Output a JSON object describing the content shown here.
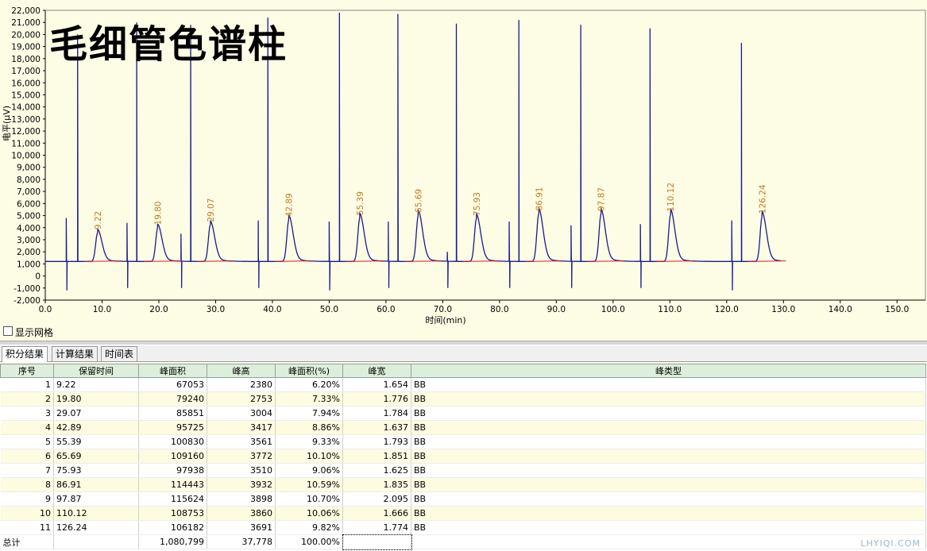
{
  "overlay_title": "毛细管色谱柱",
  "show_grid_label": "显示网格",
  "tabs": [
    {
      "label": "积分结果"
    },
    {
      "label": "计算结果"
    },
    {
      "label": "时间表"
    }
  ],
  "table": {
    "headers": [
      "序号",
      "保留时间",
      "峰面积",
      "峰高",
      "峰面积(%)",
      "峰宽",
      "峰类型"
    ],
    "rows": [
      [
        "1",
        "9.22",
        "67053",
        "2380",
        "6.20%",
        "1.654",
        "BB"
      ],
      [
        "2",
        "19.80",
        "79240",
        "2753",
        "7.33%",
        "1.776",
        "BB"
      ],
      [
        "3",
        "29.07",
        "85851",
        "3004",
        "7.94%",
        "1.784",
        "BB"
      ],
      [
        "4",
        "42.89",
        "95725",
        "3417",
        "8.86%",
        "1.637",
        "BB"
      ],
      [
        "5",
        "55.39",
        "100830",
        "3561",
        "9.33%",
        "1.793",
        "BB"
      ],
      [
        "6",
        "65.69",
        "109160",
        "3772",
        "10.10%",
        "1.851",
        "BB"
      ],
      [
        "7",
        "75.93",
        "97938",
        "3510",
        "9.06%",
        "1.625",
        "BB"
      ],
      [
        "8",
        "86.91",
        "114443",
        "3932",
        "10.59%",
        "1.835",
        "BB"
      ],
      [
        "9",
        "97.87",
        "115624",
        "3898",
        "10.70%",
        "2.095",
        "BB"
      ],
      [
        "10",
        "110.12",
        "108753",
        "3860",
        "10.06%",
        "1.666",
        "BB"
      ],
      [
        "11",
        "126.24",
        "106182",
        "3691",
        "9.82%",
        "1.774",
        "BB"
      ]
    ],
    "total": [
      "总计",
      "",
      "1,080,799",
      "37,778",
      "100.00%",
      "",
      ""
    ]
  },
  "watermark": "LHYIQI.COM",
  "colors": {
    "trace": "#1a1a8c",
    "label": "#c47a1a",
    "baseline": "#d02020",
    "chart_bg": "#fdfde6"
  },
  "chart_data": {
    "type": "line",
    "xlabel": "时间(min)",
    "ylabel": "电平(µV)",
    "xlim": [
      0,
      155
    ],
    "ylim": [
      -2000,
      22000
    ],
    "x_ticks": [
      "0.0",
      "10.0",
      "20.0",
      "30.0",
      "40.0",
      "50.0",
      "60.0",
      "70.0",
      "80.0",
      "90.0",
      "100.0",
      "110.0",
      "120.0",
      "130.0",
      "140.0",
      "150.0"
    ],
    "y_ticks": [
      "-2,000",
      "-1,000",
      "0",
      "1,000",
      "2,000",
      "3,000",
      "4,000",
      "5,000",
      "6,000",
      "7,000",
      "8,000",
      "9,000",
      "10,000",
      "11,000",
      "12,000",
      "13,000",
      "14,000",
      "15,000",
      "16,000",
      "17,000",
      "18,000",
      "19,000",
      "20,000",
      "21,000",
      "22,000"
    ],
    "x_tick_values": [
      0,
      10,
      20,
      30,
      40,
      50,
      60,
      70,
      80,
      90,
      100,
      110,
      120,
      130,
      140,
      150
    ],
    "y_tick_values": [
      -2000,
      -1000,
      0,
      1000,
      2000,
      3000,
      4000,
      5000,
      6000,
      7000,
      8000,
      9000,
      10000,
      11000,
      12000,
      13000,
      14000,
      15000,
      16000,
      17000,
      18000,
      19000,
      20000,
      21000,
      22000
    ],
    "baseline": 1200,
    "peak_labels": [
      "9.22",
      "19.80",
      "29.07",
      "42.89",
      "55.39",
      "65.69",
      "75.93",
      "86.91",
      "97.87",
      "110.12",
      "126.24"
    ],
    "peaks": [
      {
        "rt": 9.22,
        "height": 2380
      },
      {
        "rt": 19.8,
        "height": 2753
      },
      {
        "rt": 29.07,
        "height": 3004
      },
      {
        "rt": 42.89,
        "height": 3417
      },
      {
        "rt": 55.39,
        "height": 3561
      },
      {
        "rt": 65.69,
        "height": 3772
      },
      {
        "rt": 75.93,
        "height": 3510
      },
      {
        "rt": 86.91,
        "height": 3932
      },
      {
        "rt": 97.87,
        "height": 3898
      },
      {
        "rt": 110.12,
        "height": 3860
      },
      {
        "rt": 126.24,
        "height": 3691
      }
    ],
    "spikes": [
      {
        "t": 3.7,
        "v": 4800
      },
      {
        "t": 5.7,
        "v": 20000
      },
      {
        "t": 14.4,
        "v": 4400
      },
      {
        "t": 16.1,
        "v": 21000
      },
      {
        "t": 23.9,
        "v": 3500
      },
      {
        "t": 25.6,
        "v": 20800
      },
      {
        "t": 37.5,
        "v": 4600
      },
      {
        "t": 39.2,
        "v": 21400
      },
      {
        "t": 50.0,
        "v": 4500
      },
      {
        "t": 51.8,
        "v": 21800
      },
      {
        "t": 60.4,
        "v": 4500
      },
      {
        "t": 62.1,
        "v": 21700
      },
      {
        "t": 70.8,
        "v": 2000
      },
      {
        "t": 72.4,
        "v": 20900
      },
      {
        "t": 81.7,
        "v": 4500
      },
      {
        "t": 83.4,
        "v": 21200
      },
      {
        "t": 92.6,
        "v": 4200
      },
      {
        "t": 94.3,
        "v": 20800
      },
      {
        "t": 104.8,
        "v": 4300
      },
      {
        "t": 106.5,
        "v": 20500
      },
      {
        "t": 120.9,
        "v": 4600
      },
      {
        "t": 122.6,
        "v": 19300
      }
    ],
    "dips": [
      {
        "t": 3.8,
        "v": -1200
      },
      {
        "t": 14.5,
        "v": -1000
      },
      {
        "t": 24.0,
        "v": -1000
      },
      {
        "t": 37.6,
        "v": -1000
      },
      {
        "t": 50.1,
        "v": -1200
      },
      {
        "t": 60.5,
        "v": -1000
      },
      {
        "t": 70.9,
        "v": -1000
      },
      {
        "t": 81.8,
        "v": -1000
      },
      {
        "t": 92.7,
        "v": -1000
      },
      {
        "t": 104.9,
        "v": -1000
      },
      {
        "t": 121.0,
        "v": -1200
      }
    ]
  }
}
